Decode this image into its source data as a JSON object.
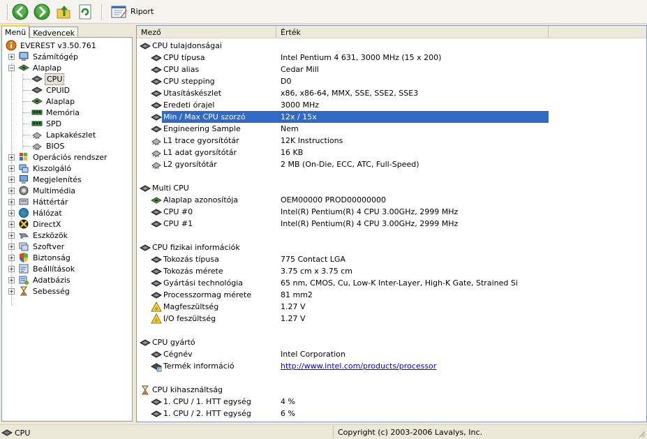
{
  "toolbar": {
    "back_icon": "back-arrow-icon",
    "forward_icon": "forward-arrow-icon",
    "up_icon": "folder-up-icon",
    "refresh_icon": "refresh-icon",
    "report_label": "Riport"
  },
  "left_tabs": [
    "Menü",
    "Kedvencek"
  ],
  "tree": {
    "root": "EVEREST v3.50.761",
    "computer": "Számítógép",
    "motherboard": "Alaplap",
    "mb_children": [
      "CPU",
      "CPUID",
      "Alaplap",
      "Memória",
      "SPD",
      "Lapkakészlet",
      "BIOS"
    ],
    "selected": "CPU",
    "rest": [
      "Operációs rendszer",
      "Kiszolgáló",
      "Megjelenítés",
      "Multimédia",
      "Háttértár",
      "Hálózat",
      "DirectX",
      "Eszközök",
      "Szoftver",
      "Biztonság",
      "Beállítások",
      "Adatbázis",
      "Sebesség"
    ]
  },
  "columns": {
    "field": "Mező",
    "value": "Érték"
  },
  "sections": [
    {
      "title": "CPU tulajdonságai",
      "rows": [
        {
          "field": "CPU típusa",
          "value": "Intel Pentium 4 631, 3000 MHz (15 x 200)"
        },
        {
          "field": "CPU alias",
          "value": "Cedar Mill"
        },
        {
          "field": "CPU stepping",
          "value": "D0"
        },
        {
          "field": "Utasításkészlet",
          "value": "x86, x86-64, MMX, SSE, SSE2, SSE3"
        },
        {
          "field": "Eredeti órajel",
          "value": "3000 MHz"
        },
        {
          "field": "Min / Max CPU szorzó",
          "value": "12x / 15x",
          "selected": true
        },
        {
          "field": "Engineering Sample",
          "value": "Nem"
        },
        {
          "field": "L1 trace gyorsítótár",
          "value": "12K Instructions"
        },
        {
          "field": "L1 adat gyorsítótár",
          "value": "16 KB"
        },
        {
          "field": "L2 gyorsítótár",
          "value": "2 MB  (On-Die, ECC, ATC, Full-Speed)"
        }
      ]
    },
    {
      "title": "Multi CPU",
      "rows": [
        {
          "field": "Alaplap azonosítója",
          "value": "OEM00000 PROD00000000"
        },
        {
          "field": "CPU #0",
          "value": "Intel(R) Pentium(R) 4 CPU 3.00GHz, 2999 MHz"
        },
        {
          "field": "CPU #1",
          "value": "Intel(R) Pentium(R) 4 CPU 3.00GHz, 2999 MHz"
        }
      ]
    },
    {
      "title": "CPU fizikai információk",
      "rows": [
        {
          "field": "Tokozás típusa",
          "value": "775 Contact LGA"
        },
        {
          "field": "Tokozás mérete",
          "value": "3.75 cm x 3.75 cm"
        },
        {
          "field": "Gyártási technológia",
          "value": "65 nm, CMOS, Cu, Low-K Inter-Layer, High-K Gate, Strained Si"
        },
        {
          "field": "Processzormag mérete",
          "value": "81 mm2"
        },
        {
          "field": "Magfeszültség",
          "value": "1.27 V"
        },
        {
          "field": "I/O feszültség",
          "value": "1.27 V"
        }
      ]
    },
    {
      "title": "CPU gyártó",
      "rows": [
        {
          "field": "Cégnév",
          "value": "Intel Corporation"
        },
        {
          "field": "Termék információ",
          "value": "http://www.intel.com/products/processor",
          "link": true
        }
      ]
    },
    {
      "title": "CPU kihasználtság",
      "rows": [
        {
          "field": "1. CPU / 1. HTT egység",
          "value": "4 %"
        },
        {
          "field": "1. CPU / 2. HTT egység",
          "value": "6 %"
        }
      ]
    }
  ],
  "status": {
    "left": "CPU",
    "right": "Copyright (c) 2003-2006 Lavalys, Inc."
  },
  "colors": {
    "selection": "#316ac5",
    "link": "#0000ee",
    "frame": "#ece9d8"
  }
}
